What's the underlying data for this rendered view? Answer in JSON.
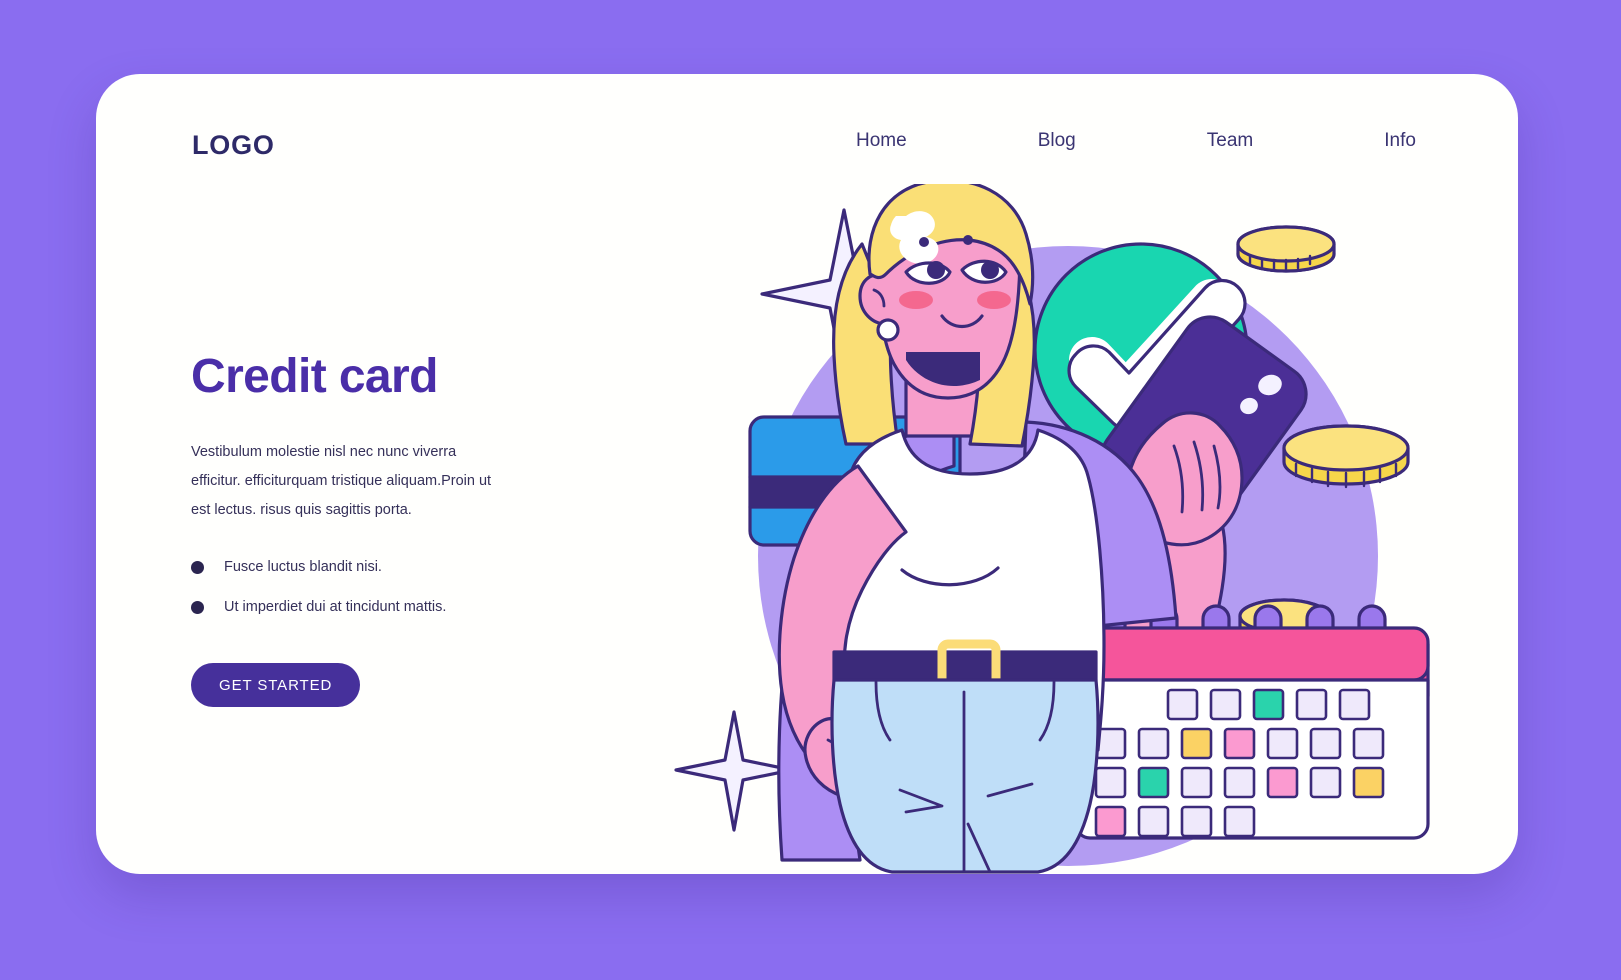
{
  "page": {
    "background_color": "#8a6df0",
    "card_background": "#fffffd"
  },
  "header": {
    "logo_text": "LOGO",
    "logo_color": "#2e2a68",
    "nav": [
      {
        "label": "Home"
      },
      {
        "label": "Blog"
      },
      {
        "label": "Team"
      },
      {
        "label": "Info"
      }
    ]
  },
  "hero": {
    "title": "Credit card",
    "title_color": "#4a2ea8",
    "paragraph": "Vestibulum molestie nisl nec nunc viverra efficitur. efficiturquam tristique aliquam.Proin ut est lectus. risus quis sagittis porta.",
    "bullets": [
      {
        "text": "Fusce luctus blandit nisi."
      },
      {
        "text": "Ut imperdiet dui at tincidunt mattis."
      }
    ],
    "cta_label": "GET STARTED",
    "cta_color": "#46309b"
  },
  "illustration": {
    "name": "woman-with-calendar-and-phone",
    "backdrop_circle_color": "#b39cf2",
    "outline_color": "#3b2a7a",
    "skin_color": "#f79ecb",
    "hair_color": "#fadf76",
    "top_color": "#ffffff",
    "jeans_color": "#bfdef8",
    "jacket_color": "#ac8ef4",
    "credit_card": {
      "name": "credit-card-icon",
      "face_color": "#2b9be9",
      "stripe_color": "#3b2a7a"
    },
    "check_badge": {
      "name": "check-circle-icon",
      "circle_color": "#19d6b0",
      "mark_color": "#ffffff"
    },
    "phone": {
      "name": "smartphone-icon",
      "body_color": "#4b2f96"
    },
    "coins": {
      "name": "coin-icon",
      "face_color": "#fbe27f",
      "edge_color": "#f6d64a",
      "count": 4
    },
    "sparkles": {
      "name": "sparkle-icon",
      "fill_color": "#f4f1ff",
      "count": 3
    },
    "belt": {
      "strap_color": "#3b2a7a",
      "buckle_color": "#fbdc78"
    },
    "calendar": {
      "name": "calendar-icon",
      "header_color": "#f5559b",
      "body_color": "#ffffff",
      "ring_color": "#9a78ec",
      "cell_default": "#efe9fb",
      "cell_teal": "#2ad3ac",
      "cell_yellow": "#fbd264",
      "cell_pink": "#fb9ad0",
      "grid": [
        [
          "none",
          "none",
          "default",
          "default",
          "teal",
          "default",
          "default"
        ],
        [
          "default",
          "default",
          "yellow",
          "pink",
          "default",
          "default",
          "default"
        ],
        [
          "default",
          "teal",
          "default",
          "default",
          "pink",
          "default",
          "yellow"
        ],
        [
          "pink",
          "default",
          "default",
          "default",
          "none",
          "none",
          "none"
        ]
      ]
    }
  }
}
